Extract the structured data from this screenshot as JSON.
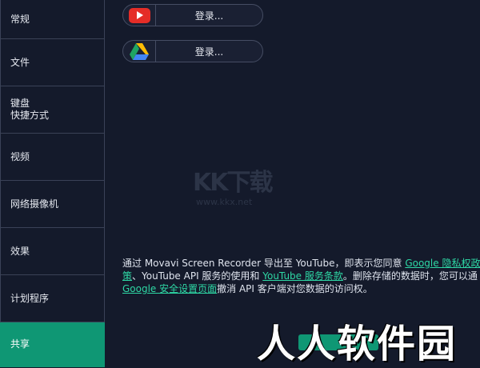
{
  "sidebar": {
    "items": [
      {
        "label": "常规",
        "active": false
      },
      {
        "label": "文件",
        "active": false
      },
      {
        "label": "键盘\n快捷方式",
        "active": false
      },
      {
        "label": "视频",
        "active": false
      },
      {
        "label": "网络摄像机",
        "active": false
      },
      {
        "label": "效果",
        "active": false
      },
      {
        "label": "计划程序",
        "active": false
      },
      {
        "label": "共享",
        "active": true
      }
    ]
  },
  "accounts": [
    {
      "service_icon": "youtube-icon",
      "login_label": "登录..."
    },
    {
      "service_icon": "google-drive-icon",
      "login_label": "登录..."
    }
  ],
  "watermark": {
    "kk": "KK下载",
    "url": "www.kkx.net",
    "site": "人人软件园"
  },
  "notice": {
    "line1_text": "通过 Movavi Screen Recorder 导出至 YouTube，即表示您同意 ",
    "line1_link": "Google 隐私权政",
    "line2_link_cont": "策",
    "line2_text_a": "、YouTube API 服务的使用和 ",
    "line2_link": "YouTube 服务条款",
    "line2_text_b": "。删除存储的数据时，您可以通",
    "line3_link": "Google 安全设置页面",
    "line3_text": "撤消 API 客户端对您数据的访问权。"
  },
  "colors": {
    "background": "#141a2b",
    "accent": "#0f9774",
    "link": "#2ed8a5"
  }
}
